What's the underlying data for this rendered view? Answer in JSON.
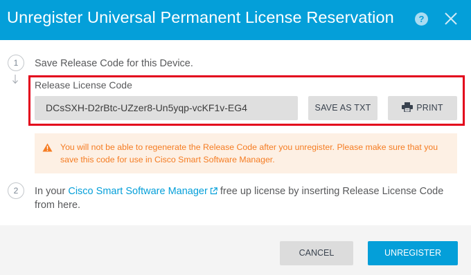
{
  "dialog": {
    "title": "Unregister Universal Permanent License Reservation",
    "help_icon": "question-mark-icon",
    "close_icon": "close-icon"
  },
  "step1": {
    "number": "1",
    "text": "Save Release Code for this Device.",
    "field_label": "Release License Code",
    "code_value": "DCsSXH-D2rBtc-UZzer8-Un5yqp-vcKF1v-EG4",
    "save_button": "SAVE AS TXT",
    "print_button": "PRINT"
  },
  "warning": {
    "text": "You will not be able to regenerate the Release Code after you unregister. Please make sure that you save this code for use in Cisco Smart Software Manager."
  },
  "step2": {
    "number": "2",
    "text_before": "In your ",
    "link_text": "Cisco Smart Software Manager",
    "text_after": " free up license by inserting Release License Code from here."
  },
  "footer": {
    "cancel_button": "CANCEL",
    "unregister_button": "UNREGISTER"
  },
  "colors": {
    "header": "#049fd9",
    "primary_button": "#049fd9",
    "highlight_border": "#e3001b",
    "warning_text": "#f57c22",
    "warning_background": "#fdf0e4"
  }
}
